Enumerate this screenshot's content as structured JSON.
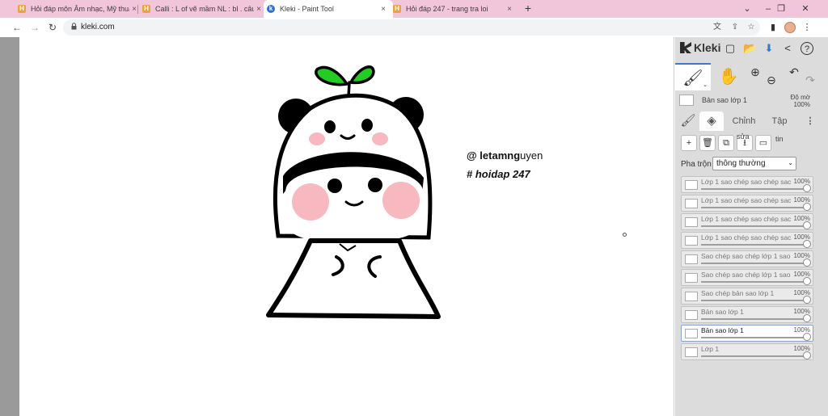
{
  "browser": {
    "tabs": [
      {
        "label": "Hỏi đáp môn Âm nhạc, Mỹ thuật",
        "icon": "hoidap-favicon-icon",
        "active": false
      },
      {
        "label": "Calli : L of vẽ mầm NL : bl . câu h",
        "icon": "hoidap-favicon-icon",
        "active": false
      },
      {
        "label": "Kleki - Paint Tool",
        "icon": "kleki-favicon-icon",
        "active": true
      },
      {
        "label": "Hỏi đáp 247 - trang tra loi",
        "icon": "hoidap-favicon-icon",
        "active": false
      }
    ],
    "close_glyph": "×",
    "new_tab_glyph": "+",
    "window_controls": {
      "minimize": "–",
      "restore": "❐",
      "close": "✕"
    },
    "url": "kleki.com",
    "nav": {
      "back": "←",
      "forward": "→",
      "reload": "↻"
    },
    "icon_glyphs": {
      "translate": "文",
      "share": "⇪",
      "star": "☆",
      "sidepanel": "▮",
      "menu": "⋮"
    }
  },
  "canvas": {
    "credit_line1_bold": "@ letamng",
    "credit_line1_rest": "uyen",
    "credit_line2": "# hoidap 247",
    "colors": {
      "leaf": "#22cc22",
      "blush": "#f7b8bf",
      "outline": "#000000",
      "background": "#ffffff"
    }
  },
  "panel": {
    "logo_text": "Kleki",
    "top_icons": {
      "new": "▢",
      "open": "📂",
      "download": "⬇",
      "share": "<",
      "help": "?"
    },
    "tools": {
      "brush": "🖌",
      "hand": "✋",
      "zoom_in": "⊕",
      "zoom_out": "⊖",
      "undo": "↶",
      "redo": "↷",
      "brush_caret": "⌄"
    },
    "current_layer_name": "Bản sao lớp 1",
    "opacity_label": "Độ mờ",
    "opacity_value": "100%",
    "tabs": {
      "adjust": "Chỉnh",
      "file": "Tập",
      "more": "⋮"
    },
    "tooltips": {
      "edit": "sửa",
      "file": "tin"
    },
    "layer_actions": {
      "add": "+",
      "delete": "🗑",
      "duplicate": "⧉",
      "merge": "⭳",
      "rename": "▭"
    },
    "blend_label": "Pha trộn",
    "blend_mode": "thông thường",
    "blend_arrow": "⌄",
    "layers": [
      {
        "name": "Lớp 1 sao chép sao chép sac",
        "opacity": "100%",
        "selected": false
      },
      {
        "name": "Lớp 1 sao chép sao chép sac",
        "opacity": "100%",
        "selected": false
      },
      {
        "name": "Lớp 1 sao chép sao chép sac",
        "opacity": "100%",
        "selected": false
      },
      {
        "name": "Lớp 1 sao chép sao chép sac",
        "opacity": "100%",
        "selected": false
      },
      {
        "name": "Sao chép sao chép lớp 1 sao",
        "opacity": "100%",
        "selected": false
      },
      {
        "name": "Sao chép sao chép lớp 1 sao",
        "opacity": "100%",
        "selected": false
      },
      {
        "name": "Sao chép bản sao lớp 1",
        "opacity": "100%",
        "selected": false
      },
      {
        "name": "Bản sao lớp 1",
        "opacity": "100%",
        "selected": false
      },
      {
        "name": "Bản sao lớp 1",
        "opacity": "100%",
        "selected": true
      },
      {
        "name": "Lớp 1",
        "opacity": "100%",
        "selected": false
      }
    ],
    "accent": "#3c79d6"
  }
}
